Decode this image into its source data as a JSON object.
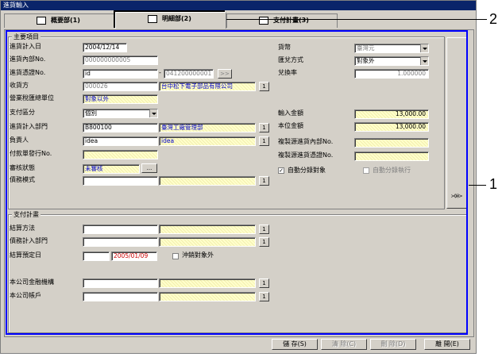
{
  "window": {
    "title": "進貨輸入"
  },
  "tabs": [
    {
      "label": "概要部(1)"
    },
    {
      "label": "明細部(2)"
    },
    {
      "label": "支付計畫(3)"
    }
  ],
  "main": {
    "legend": "主要項目",
    "purchase_date": {
      "label": "進貨計入日",
      "value": "2004/12/14"
    },
    "internal_no": {
      "label": "進貨內部No.",
      "value": "000000000005"
    },
    "voucher_no": {
      "label": "進貨憑證No.",
      "value": "id",
      "value2": "041200000001",
      "sep": "-",
      "btn": ">>"
    },
    "vendor": {
      "label": "收貨方",
      "code": "000026",
      "name": "台中松下電子部品有限公司"
    },
    "tax_unit": {
      "label": "營業稅匯總單位",
      "value": "對象以外"
    },
    "pay_type": {
      "label": "支付區分",
      "value": "個別"
    },
    "dept": {
      "label": "進貨計入部門",
      "code": "B800100",
      "name": "臺灣工廠管理部"
    },
    "owner": {
      "label": "負責人",
      "code": "idea",
      "name": "idea"
    },
    "pay_slip": {
      "label": "付款單發行No."
    },
    "audit": {
      "label": "審核狀態",
      "value": "未審核",
      "btn": "..."
    },
    "debt_mode": {
      "label": "債務模式"
    },
    "currency": {
      "label": "貨幣",
      "value": "臺灣元"
    },
    "fx_method": {
      "label": "匯兌方式",
      "value": "對象外"
    },
    "fx_rate": {
      "label": "兌換率",
      "value": "1.000000"
    },
    "in_amount": {
      "label": "輸入金額",
      "value": "13,000.00"
    },
    "local_amount": {
      "label": "本位金額",
      "value": "13,000.00"
    },
    "copy_internal": {
      "label": "複製源進貨內部No."
    },
    "copy_voucher": {
      "label": "複製源進貨憑證No."
    },
    "auto_split": {
      "label": "自動分錄對象",
      "checked": "✓"
    },
    "auto_exec": {
      "label": "自動分錄執行"
    },
    "one_btn": "1",
    "side_button": {
      "arrows": ">>>",
      "label": "(I)"
    }
  },
  "payment": {
    "legend": "支付計畫",
    "method": {
      "label": "結算方法"
    },
    "debt_dept": {
      "label": "債務計入部門"
    },
    "due_date": {
      "label": "結算預定日",
      "value": "2005/01/09"
    },
    "offset": {
      "label": "沖銷對象外"
    },
    "bank": {
      "label": "本公司金融機構"
    },
    "account": {
      "label": "本公司帳戶"
    }
  },
  "buttons": {
    "save": "儲 存(S)",
    "clear": "清 除(C)",
    "delete": "刪 除(D)",
    "close": "離 開(E)"
  },
  "callouts": {
    "one": "1",
    "two": "2"
  }
}
